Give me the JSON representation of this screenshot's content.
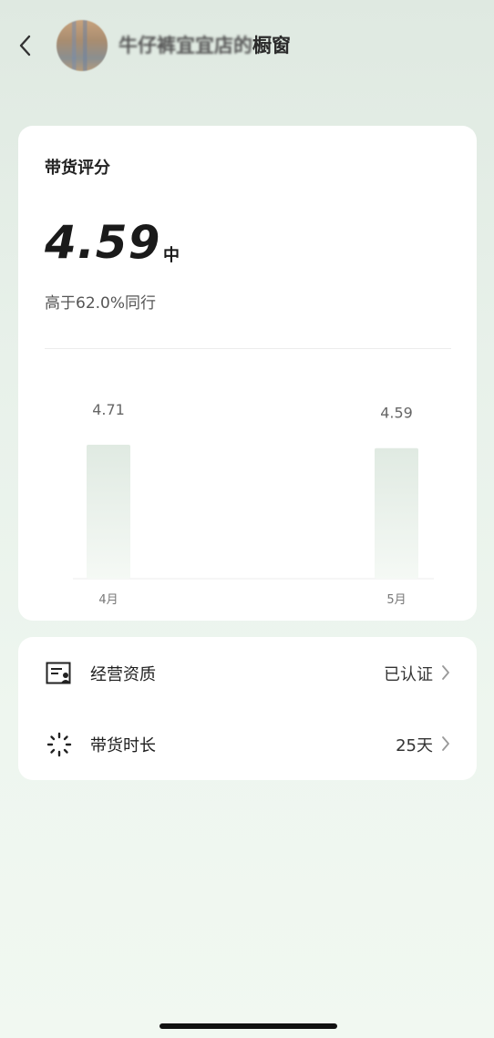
{
  "header": {
    "shop_name_blurred": "牛仔裤宜宜店的",
    "shop_name_suffix": "橱窗"
  },
  "score_card": {
    "title": "带货评分",
    "score": "4.59",
    "level": "中",
    "comparison": "高于62.0%同行"
  },
  "chart_data": {
    "type": "bar",
    "categories": [
      "4月",
      "5月"
    ],
    "values": [
      4.71,
      4.59
    ],
    "value_labels": [
      "4.71",
      "4.59"
    ],
    "bar_color": "#e3ece5",
    "grid": false
  },
  "info_card": {
    "rows": [
      {
        "label": "经营资质",
        "value": "已认证",
        "icon": "license-icon"
      },
      {
        "label": "带货时长",
        "value": "25天",
        "icon": "loading-spinner-icon"
      }
    ]
  },
  "colors": {
    "accent": "#1a1a1a",
    "background_top": "#dfe9e1",
    "background_bottom": "#f1f8f1"
  }
}
